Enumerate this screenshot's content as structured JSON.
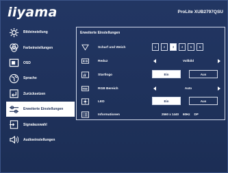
{
  "header": {
    "logo": "iiyama",
    "model": "ProLite XUB2797QSU"
  },
  "sidebar": {
    "items": [
      {
        "label": "Bildeinstellung",
        "icon": "brightness-icon"
      },
      {
        "label": "Farbeinstellungen",
        "icon": "color-icon"
      },
      {
        "label": "OSD",
        "icon": "osd-icon"
      },
      {
        "label": "Sprache",
        "icon": "globe-icon"
      },
      {
        "label": "Zurücksetzen",
        "icon": "reset-icon"
      },
      {
        "label": "Erweiterte Einstellungen",
        "icon": "advanced-settings-icon",
        "active": true
      },
      {
        "label": "Signalauswahl",
        "icon": "input-icon"
      },
      {
        "label": "Audioeinstellungen",
        "icon": "speaker-icon"
      }
    ]
  },
  "panel": {
    "title": "Erweiterte Einstellungen",
    "sharpness": {
      "label": "Scharf und Weich",
      "options": [
        "1",
        "2",
        "3",
        "4",
        "5",
        "6"
      ],
      "selected": "3"
    },
    "aspect": {
      "label": "Reduz",
      "value": "Vollbild"
    },
    "startlogo": {
      "label": "Startlogo",
      "on": "Ein",
      "off": "Aus",
      "selected": "Ein"
    },
    "rgb": {
      "label": "RGB Bereich",
      "value": "Auto"
    },
    "led": {
      "label": "LED",
      "on": "Ein",
      "off": "Aus",
      "selected": "Ein"
    },
    "info": {
      "label": "Informationen",
      "resolution": "2560 x 1440",
      "refresh": "60Hz",
      "input": "DP"
    }
  },
  "colors": {
    "background": "#1f3159",
    "highlight": "#ffffff",
    "text": "#ffffff"
  }
}
